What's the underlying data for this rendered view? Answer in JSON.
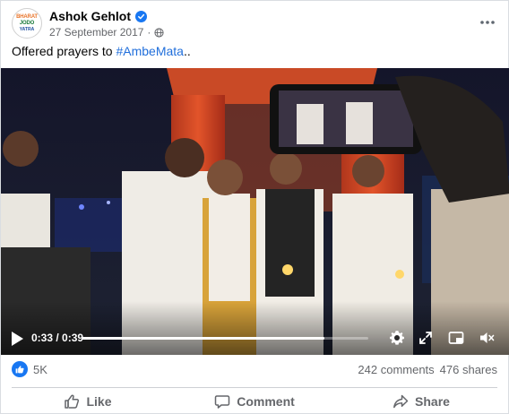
{
  "post": {
    "author": "Ashok Gehlot",
    "avatar_text": [
      "BHARAT",
      "JODO",
      "YATRA"
    ],
    "date": "27 September 2017",
    "caption_text": "Offered prayers to ",
    "caption_tag": "#AmbeMata",
    "caption_suffix": ".."
  },
  "video": {
    "current_time": "0:33",
    "duration": "0:39",
    "timer_separator": " / ",
    "progress": 0.846
  },
  "stats": {
    "reactions": "5K",
    "comments": "242 comments",
    "shares": "476 shares"
  },
  "actions": {
    "like": "Like",
    "comment": "Comment",
    "share": "Share"
  },
  "icons": {
    "verified": "verified-badge-icon",
    "privacy": "globe-icon",
    "menu": "more-horizontal-icon",
    "play": "play-icon",
    "settings": "gear-icon",
    "fullscreen": "expand-icon",
    "pip": "picture-in-picture-icon",
    "volume": "mute-icon"
  },
  "colors": {
    "brand_blue": "#1877f2",
    "link_blue": "#216fdb",
    "secondary_text": "#65676b"
  }
}
